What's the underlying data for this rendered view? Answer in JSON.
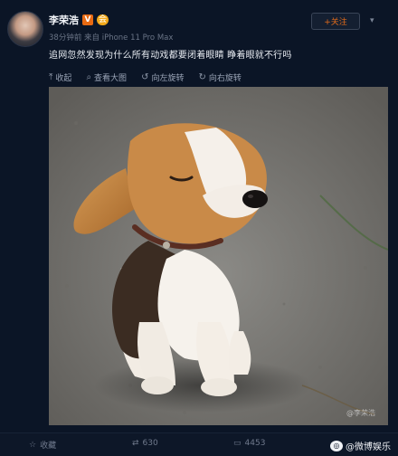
{
  "post": {
    "author": "李荣浩",
    "verified_badge": "V",
    "vip_badge": "会",
    "meta": "38分钟前 来自 iPhone 11 Pro Max",
    "follow_label": "+关注",
    "text": "追网忽然发现为什么所有动戏都要闭着眼睛 睁着眼就不行吗"
  },
  "toolbar": {
    "collapse": "收起",
    "view_large": "查看大图",
    "rotate_left": "向左旋转",
    "rotate_right": "向右旋转"
  },
  "photo": {
    "watermark": "@李荣浩"
  },
  "bottom": {
    "favorite": "收藏",
    "repost": "630",
    "comment": "4453",
    "brand": "@微博娱乐"
  },
  "colors": {
    "background": "#0b1526",
    "follow_text": "#e06b1b",
    "verified": "#e86a12"
  }
}
